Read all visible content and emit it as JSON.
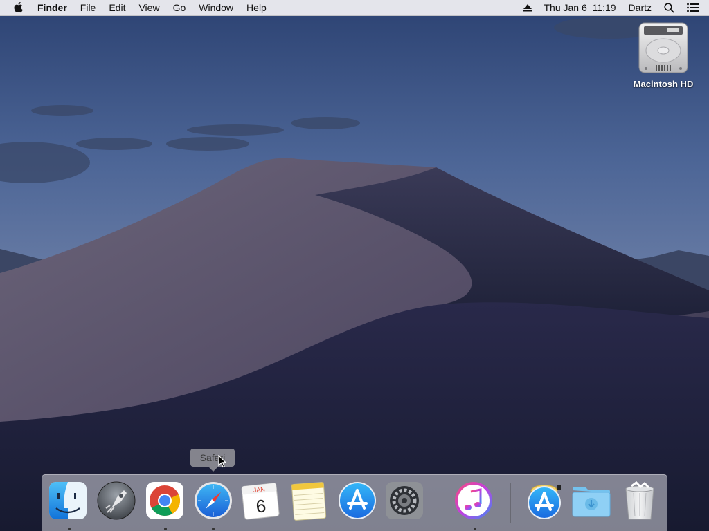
{
  "menubar": {
    "apple_icon": "apple-logo-icon",
    "app_name": "Finder",
    "items": [
      "File",
      "Edit",
      "View",
      "Go",
      "Window",
      "Help"
    ],
    "status": {
      "eject_icon": "eject-icon",
      "datetime": "Thu Jan 6  11:19",
      "user": "Dartz",
      "search_icon": "spotlight-search-icon",
      "notifications_icon": "notification-center-icon"
    }
  },
  "desktop": {
    "items": [
      {
        "label": "Macintosh HD",
        "icon": "hard-drive-icon"
      }
    ]
  },
  "tooltip": {
    "text": "Safari"
  },
  "dock": {
    "apps": [
      {
        "name": "Finder",
        "icon": "finder-icon",
        "running": true
      },
      {
        "name": "Launchpad",
        "icon": "launchpad-icon",
        "running": false
      },
      {
        "name": "Google Chrome",
        "icon": "chrome-icon",
        "running": true
      },
      {
        "name": "Safari",
        "icon": "safari-icon",
        "running": true
      },
      {
        "name": "Calendar",
        "icon": "calendar-icon",
        "running": false,
        "month": "JAN",
        "day": "6"
      },
      {
        "name": "Notes",
        "icon": "notes-icon",
        "running": false
      },
      {
        "name": "App Store",
        "icon": "app-store-icon",
        "running": false
      },
      {
        "name": "System Preferences",
        "icon": "system-preferences-icon",
        "running": false
      },
      {
        "name": "iTunes",
        "icon": "itunes-icon",
        "running": true
      },
      {
        "name": "App Store Installer",
        "icon": "app-installer-icon",
        "running": false
      },
      {
        "name": "Downloads",
        "icon": "downloads-folder-icon",
        "running": false
      },
      {
        "name": "Trash",
        "icon": "trash-icon",
        "running": false
      }
    ]
  }
}
